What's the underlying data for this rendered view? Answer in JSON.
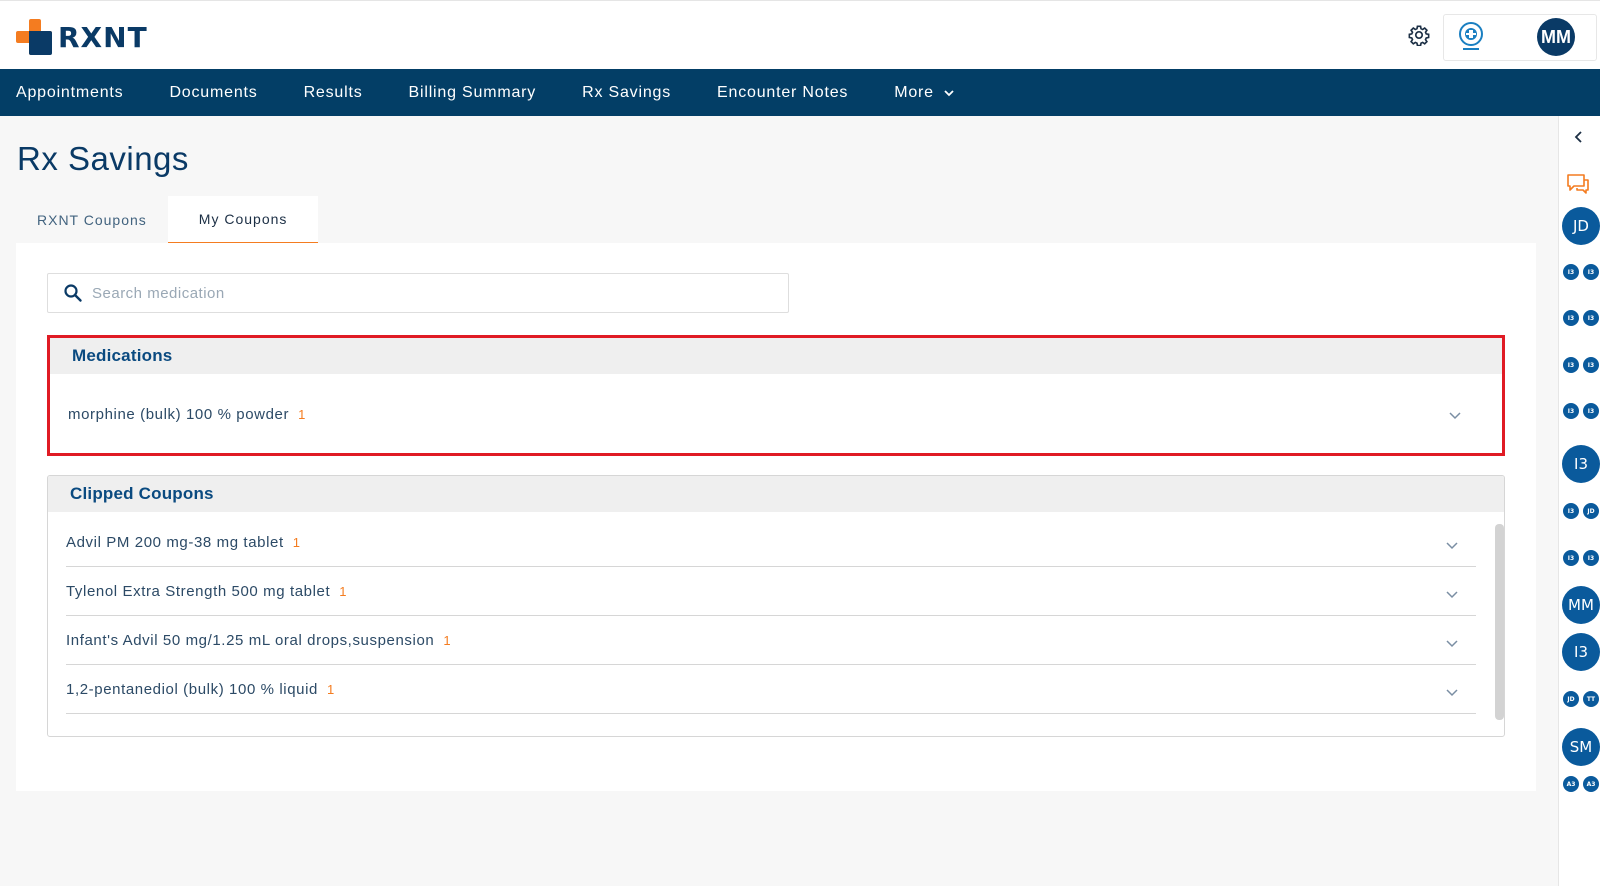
{
  "header": {
    "logo_text": "RXNT",
    "user_initials": "MM",
    "settings_icon": "gear-icon",
    "practice_logo": "medical-logo"
  },
  "nav": {
    "items": [
      {
        "label": "Appointments"
      },
      {
        "label": "Documents"
      },
      {
        "label": "Results"
      },
      {
        "label": "Billing Summary"
      },
      {
        "label": "Rx Savings"
      },
      {
        "label": "Encounter Notes"
      },
      {
        "label": "More"
      }
    ]
  },
  "page": {
    "title": "Rx Savings",
    "tabs": [
      {
        "label": "RXNT Coupons",
        "active": false
      },
      {
        "label": "My Coupons",
        "active": true
      }
    ],
    "search": {
      "placeholder": "Search medication",
      "value": ""
    }
  },
  "medications": {
    "heading": "Medications",
    "items": [
      {
        "name": "morphine (bulk) 100 % powder",
        "count": "1"
      }
    ]
  },
  "clipped_coupons": {
    "heading": "Clipped Coupons",
    "items": [
      {
        "name": "Advil PM 200 mg-38 mg tablet",
        "count": "1"
      },
      {
        "name": "Tylenol Extra Strength 500 mg tablet",
        "count": "1"
      },
      {
        "name": "Infant's Advil 50 mg/1.25 mL oral drops,suspension",
        "count": "1"
      },
      {
        "name": "1,2-pentanediol (bulk) 100 % liquid",
        "count": "1"
      }
    ]
  },
  "rail": {
    "avatars": [
      {
        "initials": "JD"
      },
      {
        "initials": "I3"
      },
      {
        "initials": "MM"
      },
      {
        "initials": "I3"
      },
      {
        "initials": "SM"
      }
    ],
    "small_badges": [
      [
        "I3",
        "I3"
      ],
      [
        "I3",
        "I3"
      ],
      [
        "I3",
        "I3"
      ],
      [
        "I3",
        "I3"
      ],
      [
        "I3",
        "JD"
      ],
      [
        "I3",
        "I3"
      ],
      [
        "JD",
        "TT"
      ],
      [
        "A3",
        "A3"
      ]
    ]
  },
  "colors": {
    "brand_navy": "#033e66",
    "accent_orange": "#f47c20",
    "highlight_red": "#e01b24"
  }
}
